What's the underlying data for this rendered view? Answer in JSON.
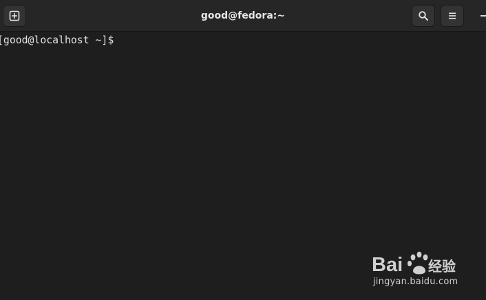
{
  "window": {
    "title": "good@fedora:~"
  },
  "headerbar": {
    "buttons": {
      "new_tab": {
        "icon": "new-tab-icon"
      },
      "search": {
        "icon": "search-icon"
      },
      "menu": {
        "icon": "hamburger-menu-icon"
      },
      "minimize": {
        "icon": "minimize-icon"
      }
    }
  },
  "terminal": {
    "prompt": "[good@localhost ~]$ "
  },
  "watermark": {
    "logo_text": "Bai 经验",
    "url": "jingyan.baidu.com"
  },
  "colors": {
    "headerbar_bg": "#262626",
    "terminal_bg": "#1e1e1e",
    "text": "#e2e2e2"
  }
}
